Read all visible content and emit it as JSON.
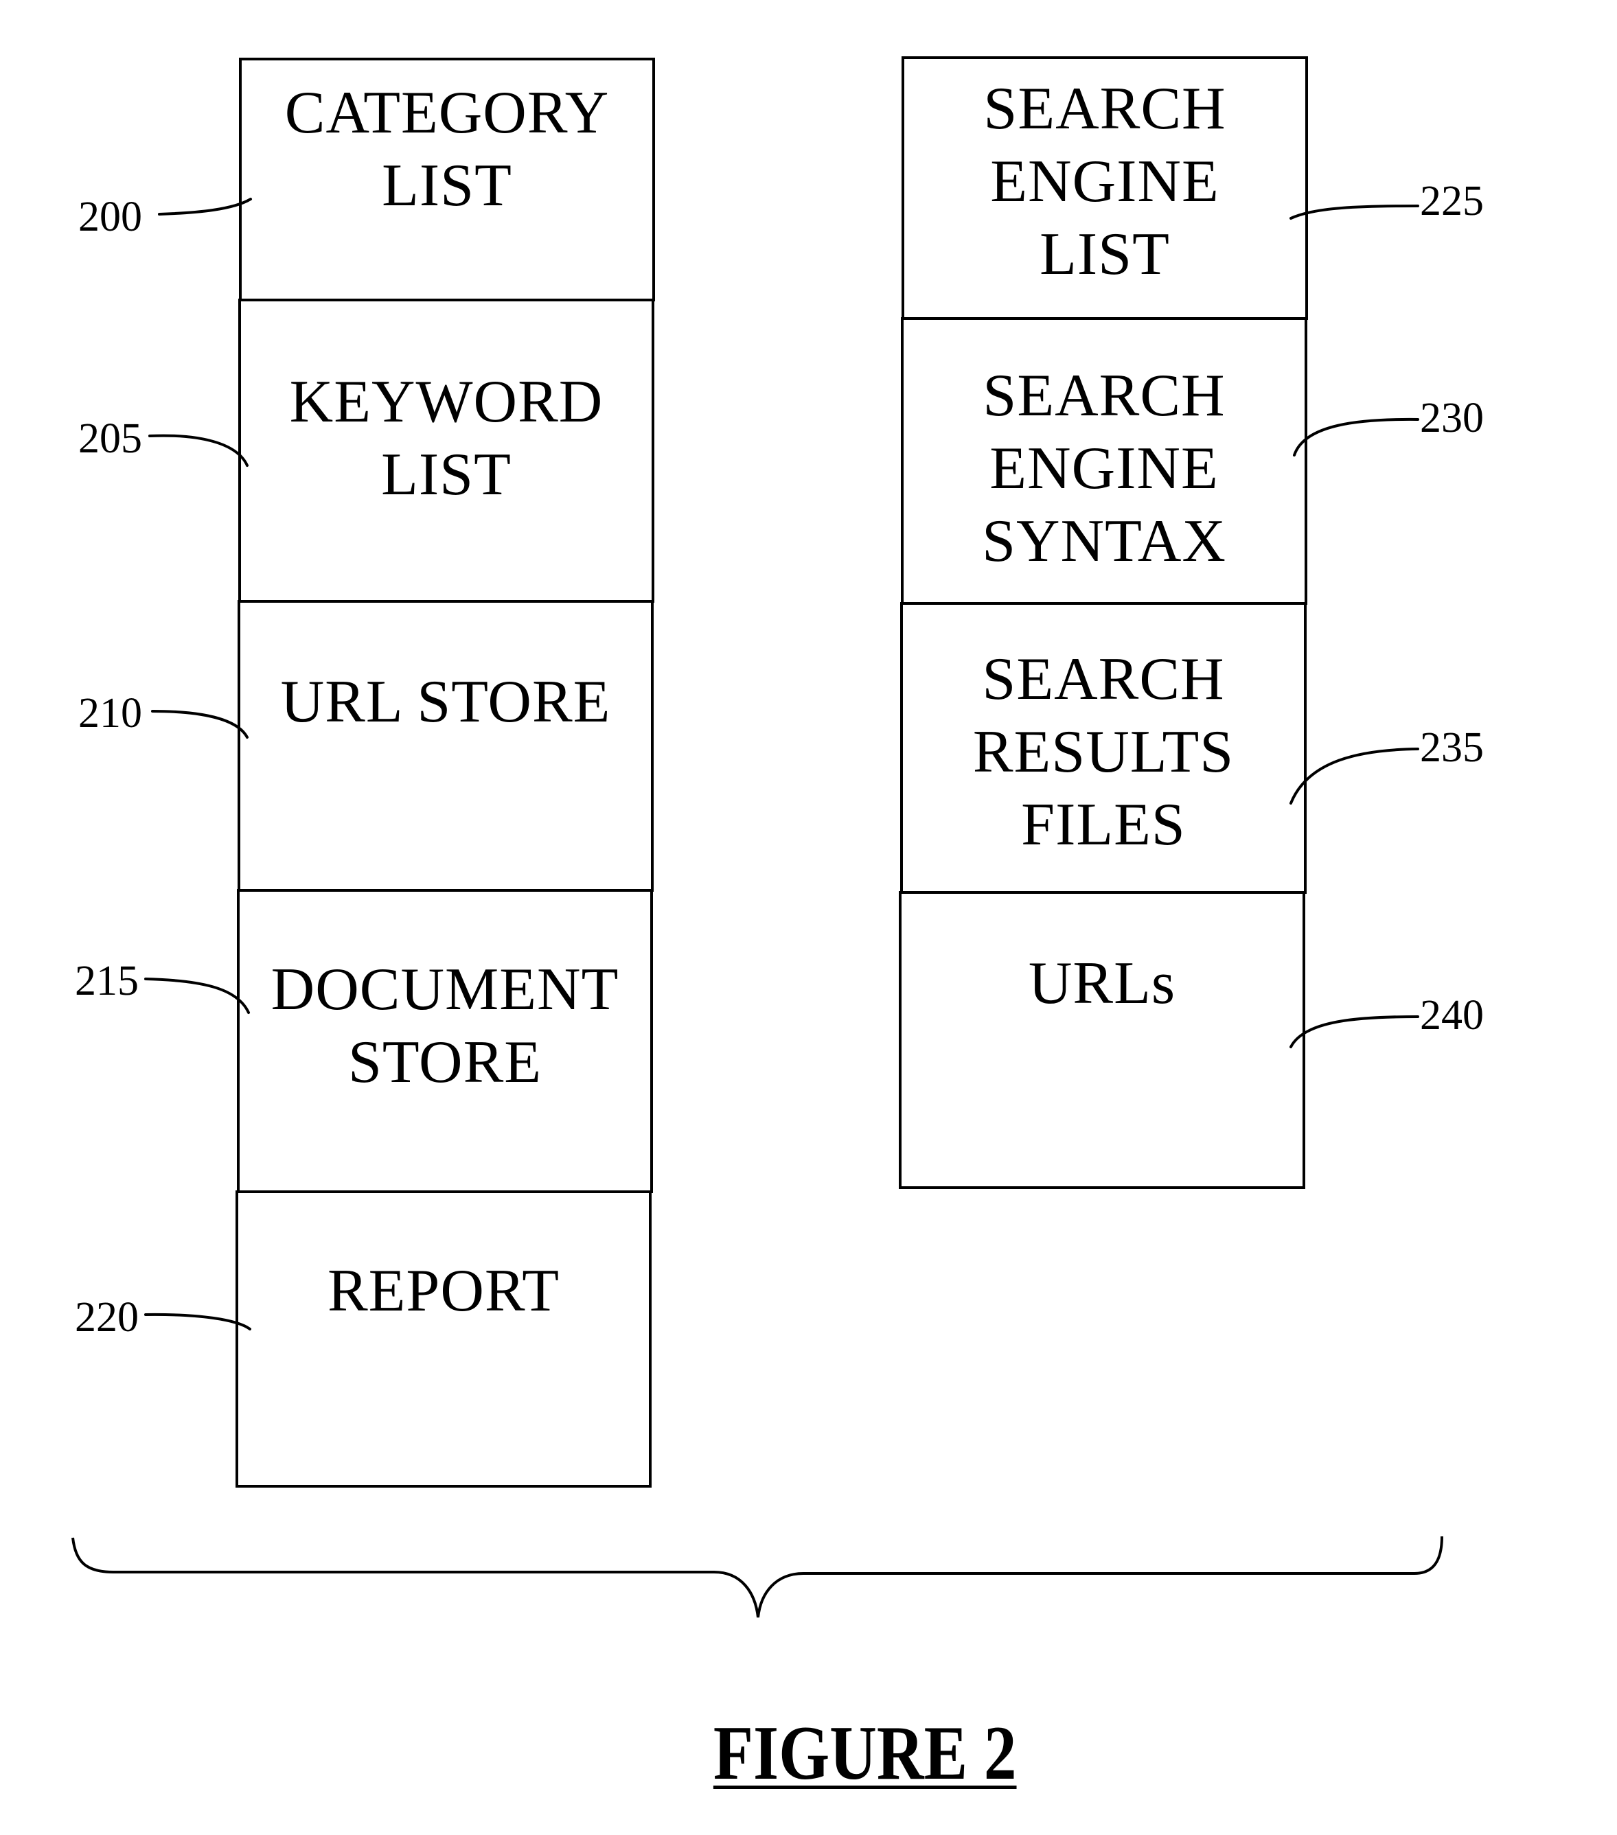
{
  "figure": {
    "caption": "FIGURE 2"
  },
  "left_column": {
    "cells": [
      {
        "ref": "200",
        "lines": [
          "CATEGORY",
          "LIST"
        ]
      },
      {
        "ref": "205",
        "lines": [
          "KEYWORD",
          "LIST"
        ]
      },
      {
        "ref": "210",
        "lines": [
          "URL STORE"
        ]
      },
      {
        "ref": "215",
        "lines": [
          "DOCUMENT",
          "STORE"
        ]
      },
      {
        "ref": "220",
        "lines": [
          "REPORT"
        ]
      }
    ]
  },
  "right_column": {
    "cells": [
      {
        "ref": "225",
        "lines": [
          "SEARCH",
          "ENGINE",
          "LIST"
        ]
      },
      {
        "ref": "230",
        "lines": [
          "SEARCH",
          "ENGINE",
          "SYNTAX"
        ]
      },
      {
        "ref": "235",
        "lines": [
          "SEARCH",
          "RESULTS",
          "FILES"
        ]
      },
      {
        "ref": "240",
        "lines": [
          "URLs"
        ]
      }
    ]
  }
}
